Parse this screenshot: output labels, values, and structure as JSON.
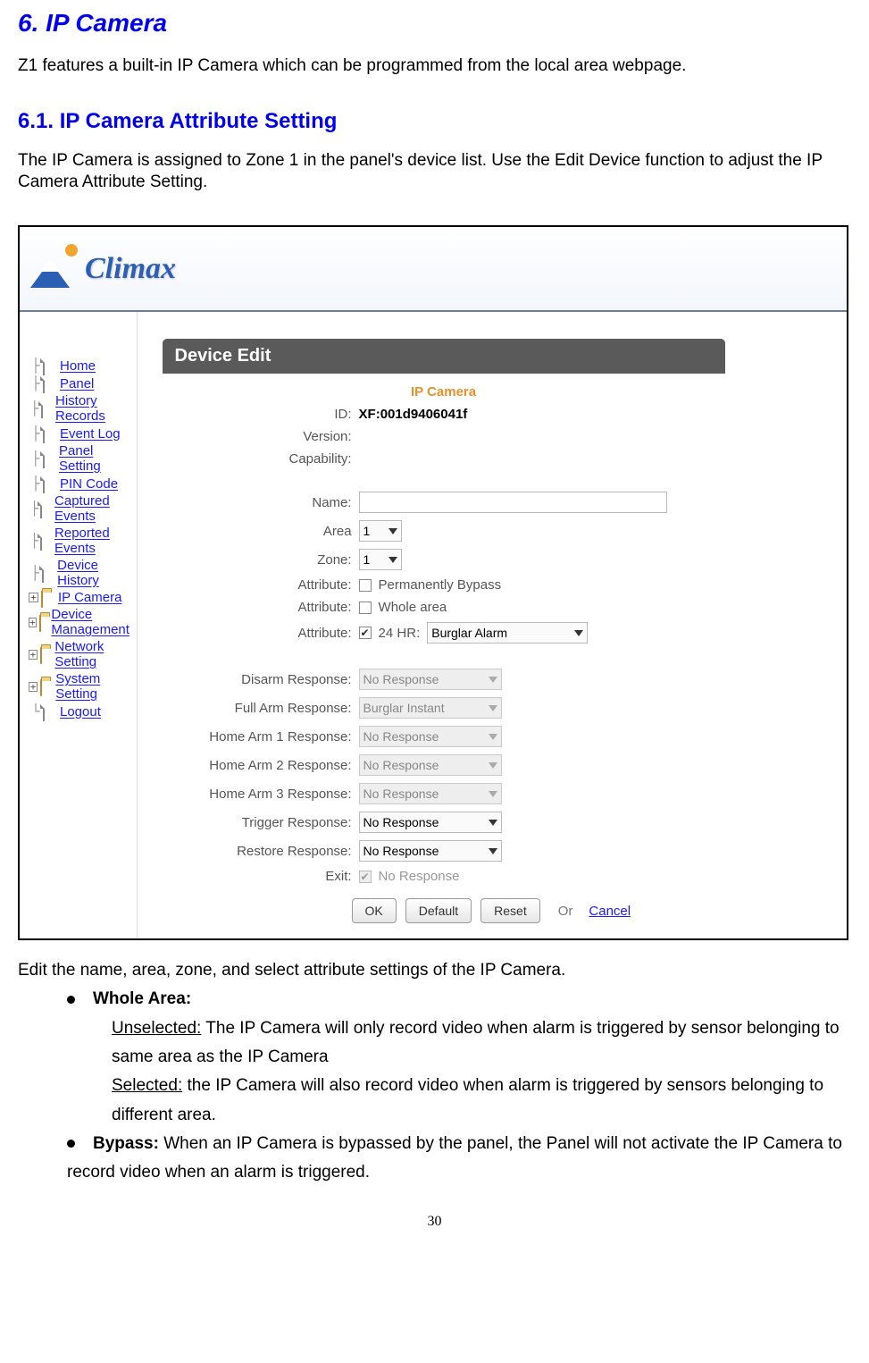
{
  "doc": {
    "h1": "6.  IP Camera",
    "intro": "Z1 features a built-in IP Camera which can be programmed from the local area webpage.",
    "h2": "6.1. IP Camera Attribute Setting",
    "p2": "The IP Camera is assigned to Zone 1 in the panel's device list. Use the Edit Device function to adjust the IP Camera Attribute Setting.",
    "editIntro": "Edit the name, area, zone, and select attribute settings of the IP Camera.",
    "bullet1_title": "Whole Area:",
    "bullet1_un_label": "Unselected:",
    "bullet1_un_text": " The IP Camera will only record video when alarm is triggered by sensor belonging to same area as the IP Camera",
    "bullet1_sel_label": "Selected:",
    "bullet1_sel_text": " the IP Camera will also record video when alarm is triggered by sensors belonging to different area.",
    "bullet2_title": "Bypass:",
    "bullet2_text": " When an IP Camera is bypassed by the panel, the Panel will not activate the IP Camera to record video when an alarm is triggered.",
    "pagenum": "30"
  },
  "ui": {
    "logo": "Climax",
    "nav": {
      "home": "Home",
      "panel": "Panel",
      "history": "History Records",
      "event": "Event Log",
      "psetting": "Panel Setting",
      "pin": "PIN Code",
      "captured": "Captured Events",
      "reported": "Reported Events",
      "dhistory": "Device History",
      "ipcam": "IP Camera",
      "dmgmt": "Device Management",
      "net": "Network Setting",
      "sys": "System Setting",
      "logout": "Logout"
    },
    "panelTitle": "Device Edit",
    "deviceHeading": "IP Camera",
    "labels": {
      "id": "ID:",
      "version": "Version:",
      "capability": "Capability:",
      "name": "Name:",
      "area": "Area",
      "zone": "Zone:",
      "attr": "Attribute:",
      "bypass": "Permanently Bypass",
      "whole": "Whole area",
      "hr24": "24 HR:",
      "disarm": "Disarm Response:",
      "fullarm": "Full Arm Response:",
      "h1": "Home Arm 1 Response:",
      "h2": "Home Arm 2 Response:",
      "h3": "Home Arm 3 Response:",
      "trigger": "Trigger Response:",
      "restore": "Restore Response:",
      "exit": "Exit:",
      "exitval": "No Response"
    },
    "values": {
      "id": "XF:001d9406041f",
      "area": "1",
      "zone": "1",
      "hr24sel": "Burglar Alarm",
      "disarm": "No Response",
      "fullarm": "Burglar Instant",
      "h1": "No Response",
      "h2": "No Response",
      "h3": "No Response",
      "trigger": "No Response",
      "restore": "No Response"
    },
    "buttons": {
      "ok": "OK",
      "default": "Default",
      "reset": "Reset",
      "or": "Or",
      "cancel": "Cancel"
    }
  }
}
